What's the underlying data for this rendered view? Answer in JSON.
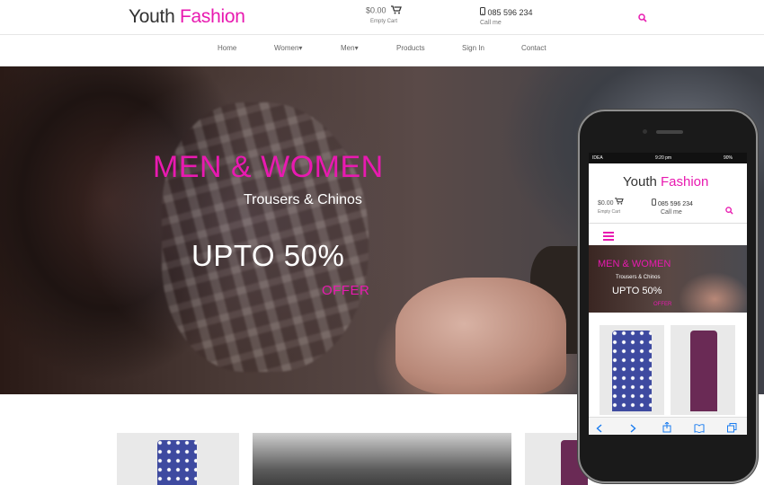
{
  "brand": {
    "word1": "Youth",
    "word2": "Fashion",
    "accent": "#e81ab0"
  },
  "header": {
    "cart_amount": "$0.00",
    "cart_label": "Empty Cart",
    "phone_number": "085 596 234",
    "phone_label": "Call me"
  },
  "nav": {
    "items": [
      {
        "label": "Home"
      },
      {
        "label": "Women"
      },
      {
        "label": "Men"
      },
      {
        "label": "Products"
      },
      {
        "label": "Sign In"
      },
      {
        "label": "Contact"
      }
    ]
  },
  "hero": {
    "title": "MEN & WOMEN",
    "subtitle": "Trousers & Chinos",
    "promo": "UPTO 50%",
    "offer": "OFFER"
  },
  "mobile": {
    "status_carrier": "IDEA",
    "status_time": "9:20 pm",
    "status_battery": "90%",
    "brand_word1": "Youth",
    "brand_word2": "Fashion",
    "cart_amount": "$0.00",
    "cart_label": "Empty Cart",
    "phone_number": "085 596 234",
    "phone_label": "Call me",
    "hero_title": "MEN & WOMEN",
    "hero_subtitle": "Trousers & Chinos",
    "hero_promo": "UPTO 50%",
    "hero_offer": "OFFER"
  },
  "icons": {
    "cart": "cart-icon",
    "search": "search-icon",
    "phone": "phone-icon",
    "menu": "hamburger-icon",
    "back": "chevron-left-icon",
    "forward": "chevron-right-icon",
    "share": "share-icon",
    "bookmarks": "book-icon",
    "tabs": "tabs-icon"
  }
}
